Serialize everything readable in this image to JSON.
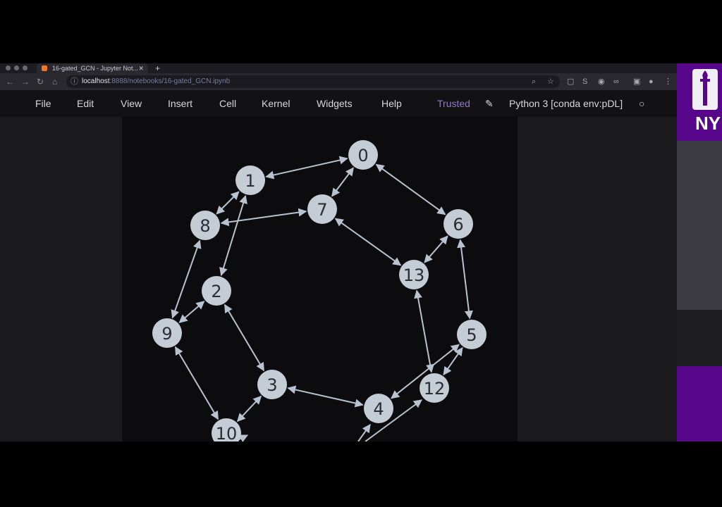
{
  "browser": {
    "tab_title": "16-gated_GCN - Jupyter Not...",
    "url_host": "localhost",
    "url_path": ":8888/notebooks/16-gated_GCN.ipynb"
  },
  "menu": {
    "file": "File",
    "edit": "Edit",
    "view": "View",
    "insert": "Insert",
    "cell": "Cell",
    "kernel": "Kernel",
    "widgets": "Widgets",
    "help": "Help",
    "trusted": "Trusted",
    "kernel_name": "Python 3 [conda env:pDL]"
  },
  "graph": {
    "nodes": [
      {
        "id": "n0",
        "label": "0"
      },
      {
        "id": "n1",
        "label": "1"
      },
      {
        "id": "n2",
        "label": "2"
      },
      {
        "id": "n3",
        "label": "3"
      },
      {
        "id": "n4",
        "label": "4"
      },
      {
        "id": "n5",
        "label": "5"
      },
      {
        "id": "n6",
        "label": "6"
      },
      {
        "id": "n7",
        "label": "7"
      },
      {
        "id": "n8",
        "label": "8"
      },
      {
        "id": "n9",
        "label": "9"
      },
      {
        "id": "n10",
        "label": "10"
      },
      {
        "id": "n12",
        "label": "12"
      },
      {
        "id": "n13",
        "label": "13"
      }
    ],
    "edges": [
      [
        "0",
        "1"
      ],
      [
        "0",
        "7"
      ],
      [
        "0",
        "6"
      ],
      [
        "1",
        "8"
      ],
      [
        "1",
        "2"
      ],
      [
        "8",
        "7"
      ],
      [
        "8",
        "9"
      ],
      [
        "7",
        "13"
      ],
      [
        "6",
        "13"
      ],
      [
        "6",
        "5"
      ],
      [
        "9",
        "2"
      ],
      [
        "2",
        "3"
      ],
      [
        "9",
        "10"
      ],
      [
        "3",
        "10"
      ],
      [
        "3",
        "4"
      ],
      [
        "13",
        "12"
      ],
      [
        "5",
        "12"
      ],
      [
        "5",
        "4"
      ]
    ]
  },
  "side_panel": {
    "logo_text": "NY"
  },
  "colors": {
    "node_fill": "#c4ccd6",
    "edge": "#b8c2d0",
    "trusted": "#8e7cc3",
    "nyu_purple": "#57068c"
  }
}
